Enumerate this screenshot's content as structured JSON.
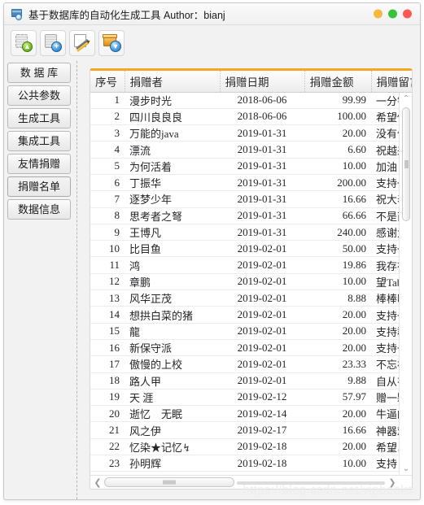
{
  "window": {
    "title": "基于数据库的自动化生成工具  Author：bianj",
    "icon": "database-icon",
    "controls": [
      {
        "name": "minimize-button",
        "color": "#f6b83d"
      },
      {
        "name": "maximize-button",
        "color": "#3ac13a"
      },
      {
        "name": "close-button",
        "color": "#f95b52"
      }
    ]
  },
  "toolbar": {
    "buttons": [
      {
        "name": "connect-database-button",
        "icon": "database-up-icon",
        "framed": true
      },
      {
        "name": "add-database-button",
        "icon": "database-add-icon",
        "framed": true
      },
      {
        "name": "settings-tools-button",
        "icon": "tools-icon",
        "framed": true
      },
      {
        "name": "export-button",
        "icon": "export-package-icon",
        "framed": true
      }
    ]
  },
  "sidebar": {
    "items": [
      {
        "label": "数 据 库",
        "selected": false
      },
      {
        "label": "公共参数",
        "selected": false
      },
      {
        "label": "生成工具",
        "selected": false
      },
      {
        "label": "集成工具",
        "selected": false
      },
      {
        "label": "友情捐赠",
        "selected": false
      },
      {
        "label": "捐赠名单",
        "selected": true
      },
      {
        "label": "数据信息",
        "selected": false
      }
    ]
  },
  "table": {
    "accent_color": "#f5a623",
    "columns": [
      "序号",
      "捐赠者",
      "捐赠日期",
      "捐赠金额",
      "捐赠留言"
    ],
    "rows": [
      [
        "1",
        "漫步时光",
        "2018-06-06",
        "99.99",
        "一分钱换个"
      ],
      [
        "2",
        "四川良良良",
        "2018-06-06",
        "100.00",
        "希望做的更"
      ],
      [
        "3",
        "万能的java",
        "2019-01-31",
        "20.00",
        "没有什么比"
      ],
      [
        "4",
        "漂流",
        "2019-01-31",
        "6.60",
        "祝越来越好"
      ],
      [
        "5",
        "为何活着",
        "2019-01-31",
        "10.00",
        "加油"
      ],
      [
        "6",
        "丁振华",
        "2019-01-31",
        "200.00",
        "支持一下"
      ],
      [
        "7",
        "逐梦少年",
        "2019-01-31",
        "16.66",
        "祝大表哥里"
      ],
      [
        "8",
        "思考者之弩",
        "2019-01-31",
        "66.66",
        "不是商户，"
      ],
      [
        "9",
        "王博凡",
        "2019-01-31",
        "240.00",
        "感谢大表哥"
      ],
      [
        "10",
        "比目鱼",
        "2019-02-01",
        "50.00",
        "支持一下"
      ],
      [
        "11",
        "鸿",
        "2019-02-01",
        "19.86",
        "我存在你深"
      ],
      [
        "12",
        "章鹏",
        "2019-02-01",
        "10.00",
        "望TableGo"
      ],
      [
        "13",
        "风华正茂",
        "2019-02-01",
        "8.88",
        "棒棒哒"
      ],
      [
        "14",
        "想拱白菜的猪",
        "2019-02-01",
        "20.00",
        "支持一下"
      ],
      [
        "15",
        "龍",
        "2019-02-01",
        "20.00",
        "支持群主，"
      ],
      [
        "16",
        "新保守派",
        "2019-02-01",
        "20.00",
        "支持一下"
      ],
      [
        "17",
        "傲慢的上校",
        "2019-02-01",
        "23.33",
        "不忘初心，"
      ],
      [
        "18",
        "路人甲",
        "2019-02-01",
        "9.88",
        "自从有了你"
      ],
      [
        "19",
        "天 涯",
        "2019-02-12",
        "57.97",
        "赠一颗烟谢"
      ],
      [
        "20",
        "逝忆　无眠",
        "2019-02-14",
        "20.00",
        "牛逼的软件"
      ],
      [
        "21",
        "风之伊",
        "2019-02-17",
        "16.66",
        "神器难得一"
      ],
      [
        "22",
        "忆染★记忆↯",
        "2019-02-18",
        "20.00",
        "希望以后超"
      ],
      [
        "23",
        "孙明辉",
        "2019-02-18",
        "10.00",
        "支持，越做"
      ]
    ]
  },
  "scrollbars": {
    "vertical": {
      "up_arrow": "⌃",
      "down_arrow": "⌄"
    },
    "horizontal": {
      "left_arrow": "❮",
      "right_arrow": "❯"
    }
  },
  "watermark": {
    "text": "https://blog.csdn.net/vipbooks"
  }
}
